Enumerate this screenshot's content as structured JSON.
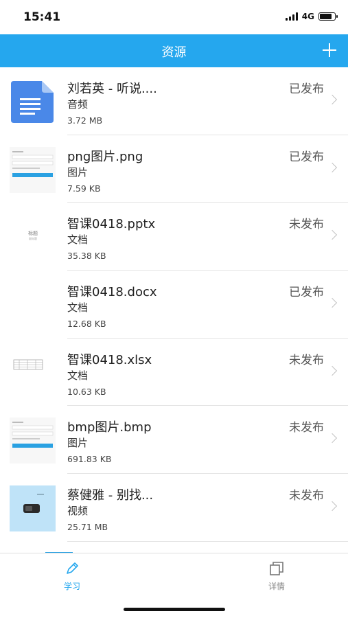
{
  "status_bar": {
    "time": "15:41",
    "network": "4G"
  },
  "header": {
    "title": "资源",
    "add_icon": "plus-icon"
  },
  "resources": [
    {
      "name": "刘若英 - 听说....",
      "type": "音频",
      "size": "3.72 MB",
      "status": "已发布",
      "thumb": "document-icon"
    },
    {
      "name": "png图片.png",
      "type": "图片",
      "size": "7.59 KB",
      "status": "已发布",
      "thumb": "form-screenshot"
    },
    {
      "name": "智课0418.pptx",
      "type": "文档",
      "size": "35.38 KB",
      "status": "未发布",
      "thumb": "slide-thumbnail",
      "thumb_text": [
        "标题",
        "副标题"
      ]
    },
    {
      "name": "智课0418.docx",
      "type": "文档",
      "size": "12.68 KB",
      "status": "已发布",
      "thumb": "blank-thumbnail"
    },
    {
      "name": "智课0418.xlsx",
      "type": "文档",
      "size": "10.63 KB",
      "status": "未发布",
      "thumb": "spreadsheet-thumbnail"
    },
    {
      "name": "bmp图片.bmp",
      "type": "图片",
      "size": "691.83 KB",
      "status": "未发布",
      "thumb": "form-screenshot"
    },
    {
      "name": "蔡健雅 - 别找...",
      "type": "视频",
      "size": "25.71 MB",
      "status": "未发布",
      "thumb": "video-thumbnail"
    }
  ],
  "tabs": [
    {
      "label": "学习",
      "icon": "pencil-icon",
      "active": true
    },
    {
      "label": "详情",
      "icon": "copy-icon",
      "active": false
    }
  ],
  "colors": {
    "accent": "#25a7ee",
    "doc_icon": "#4a88e8",
    "video_bg": "#bfe3f8"
  }
}
